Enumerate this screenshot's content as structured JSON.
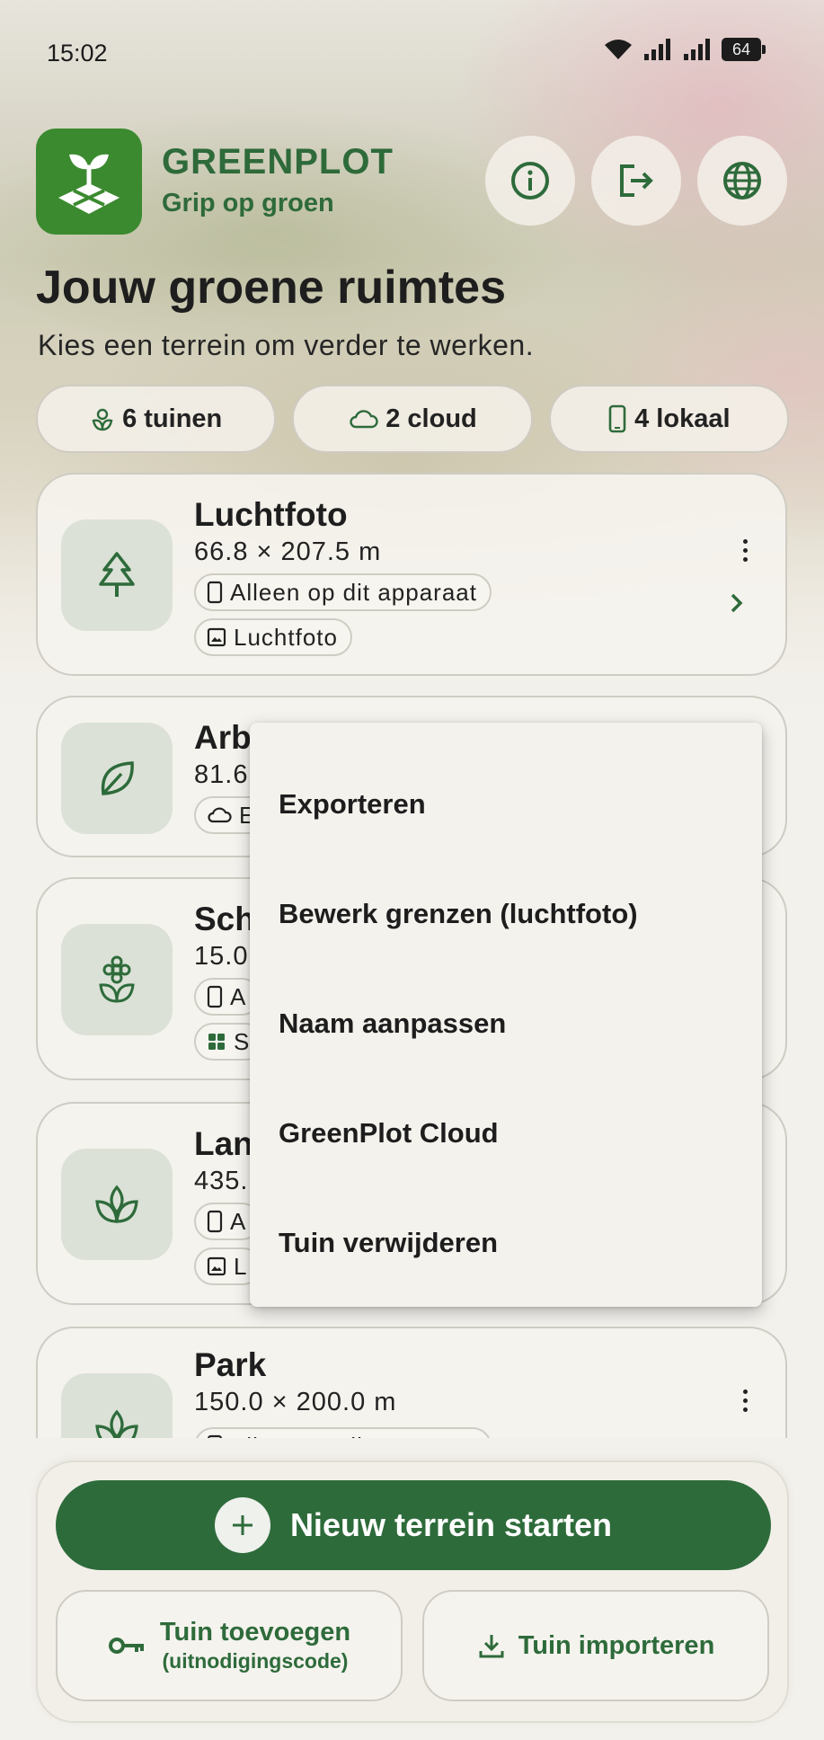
{
  "status_bar": {
    "time": "15:02",
    "battery": "64"
  },
  "app": {
    "name": "GREENPLOT",
    "tagline": "Grip op groen"
  },
  "header_buttons": [
    {
      "icon": "info-icon"
    },
    {
      "icon": "logout-icon"
    },
    {
      "icon": "globe-icon"
    }
  ],
  "page": {
    "title": "Jouw groene ruimtes",
    "subtitle": "Kies een terrein om verder te werken."
  },
  "summary_chips": [
    {
      "icon": "flower-icon",
      "label": "6 tuinen"
    },
    {
      "icon": "cloud-icon",
      "label": "2 cloud"
    },
    {
      "icon": "phone-icon",
      "label": "4 lokaal"
    }
  ],
  "gardens": [
    {
      "title": "Luchtfoto",
      "dims": "66.8 × 207.5 m",
      "icon": "tree-icon",
      "tags": [
        {
          "icon": "phone-icon",
          "label": "Alleen op dit apparaat"
        },
        {
          "icon": "image-icon",
          "label": "Luchtfoto"
        }
      ]
    },
    {
      "title": "Arb",
      "dims": "81.6",
      "icon": "leaf-icon",
      "tags": [
        {
          "icon": "cloud-icon",
          "label": "E"
        }
      ]
    },
    {
      "title": "Sch",
      "dims": "15.0",
      "icon": "flower-icon",
      "tags": [
        {
          "icon": "phone-icon",
          "label": "A"
        },
        {
          "icon": "grid-icon",
          "label": "S"
        }
      ]
    },
    {
      "title": "Lan",
      "dims": "435.",
      "icon": "sprout-icon",
      "tags": [
        {
          "icon": "phone-icon",
          "label": "A"
        },
        {
          "icon": "image-icon",
          "label": "L"
        }
      ]
    },
    {
      "title": "Park",
      "dims": "150.0 × 200.0 m",
      "icon": "sprout-icon",
      "tags": [
        {
          "icon": "phone-icon",
          "label": "Alleen op dit apparaat"
        }
      ]
    }
  ],
  "context_menu": {
    "items": [
      "Exporteren",
      "Bewerk grenzen (luchtfoto)",
      "Naam aanpassen",
      "GreenPlot Cloud",
      "Tuin verwijderen"
    ]
  },
  "actions": {
    "primary": "Nieuw terrein starten",
    "add_garden": "Tuin toevoegen",
    "add_garden_sub": "(uitnodigingscode)",
    "import_garden": "Tuin importeren"
  },
  "colors": {
    "brand": "#2e6b3b",
    "logo_bg": "#3b8a2f",
    "icon_box": "#dbe1d6"
  }
}
